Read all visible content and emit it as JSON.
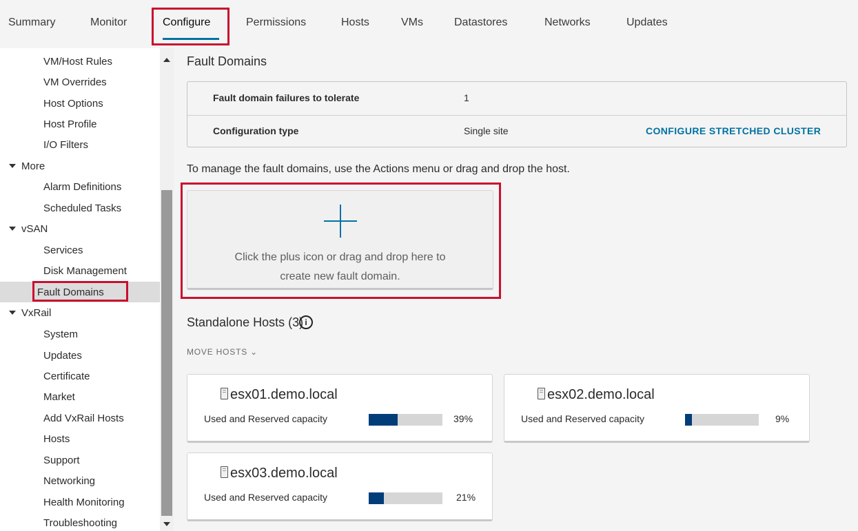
{
  "tabs": [
    {
      "label": "Summary"
    },
    {
      "label": "Monitor"
    },
    {
      "label": "Configure"
    },
    {
      "label": "Permissions"
    },
    {
      "label": "Hosts"
    },
    {
      "label": "VMs"
    },
    {
      "label": "Datastores"
    },
    {
      "label": "Networks"
    },
    {
      "label": "Updates"
    }
  ],
  "active_tab": "Configure",
  "sidebar": {
    "items": [
      {
        "label": "VM/Host Rules"
      },
      {
        "label": "VM Overrides"
      },
      {
        "label": "Host Options"
      },
      {
        "label": "Host Profile"
      },
      {
        "label": "I/O Filters"
      },
      {
        "label": "More",
        "group": true
      },
      {
        "label": "Alarm Definitions"
      },
      {
        "label": "Scheduled Tasks"
      },
      {
        "label": "vSAN",
        "group": true
      },
      {
        "label": "Services"
      },
      {
        "label": "Disk Management"
      },
      {
        "label": "Fault Domains",
        "selected": true
      },
      {
        "label": "VxRail",
        "group": true
      },
      {
        "label": "System"
      },
      {
        "label": "Updates"
      },
      {
        "label": "Certificate"
      },
      {
        "label": "Market"
      },
      {
        "label": "Add VxRail Hosts"
      },
      {
        "label": "Hosts"
      },
      {
        "label": "Support"
      },
      {
        "label": "Networking"
      },
      {
        "label": "Health Monitoring"
      },
      {
        "label": "Troubleshooting"
      }
    ]
  },
  "main": {
    "title": "Fault Domains",
    "info": {
      "rows": [
        {
          "label": "Fault domain failures to tolerate",
          "value": "1"
        },
        {
          "label": "Configuration type",
          "value": "Single site",
          "action": "CONFIGURE STRETCHED CLUSTER"
        }
      ]
    },
    "hint": "To manage the fault domains, use the Actions menu or drag and drop the host.",
    "dropzone": {
      "line1": "Click the plus icon or drag and drop here to",
      "line2": "create new fault domain."
    },
    "standalone_title": "Standalone Hosts (3)",
    "info_icon_glyph": "i",
    "move_hosts": "MOVE HOSTS ⌄",
    "hosts": [
      {
        "name": "esx01.demo.local",
        "capacity_label": "Used and Reserved capacity",
        "percent_label": "39%",
        "percent": 0.39
      },
      {
        "name": "esx02.demo.local",
        "capacity_label": "Used and Reserved capacity",
        "percent_label": "9%",
        "percent": 0.09
      },
      {
        "name": "esx03.demo.local",
        "capacity_label": "Used and Reserved capacity",
        "percent_label": "21%",
        "percent": 0.21
      }
    ]
  },
  "colors": {
    "accent": "#0072a3",
    "highlight": "#c8102e",
    "bar_fill": "#003d79"
  },
  "icons": {
    "plus": "plus-icon",
    "host": "host-server-icon",
    "info": "info-circle-icon"
  }
}
